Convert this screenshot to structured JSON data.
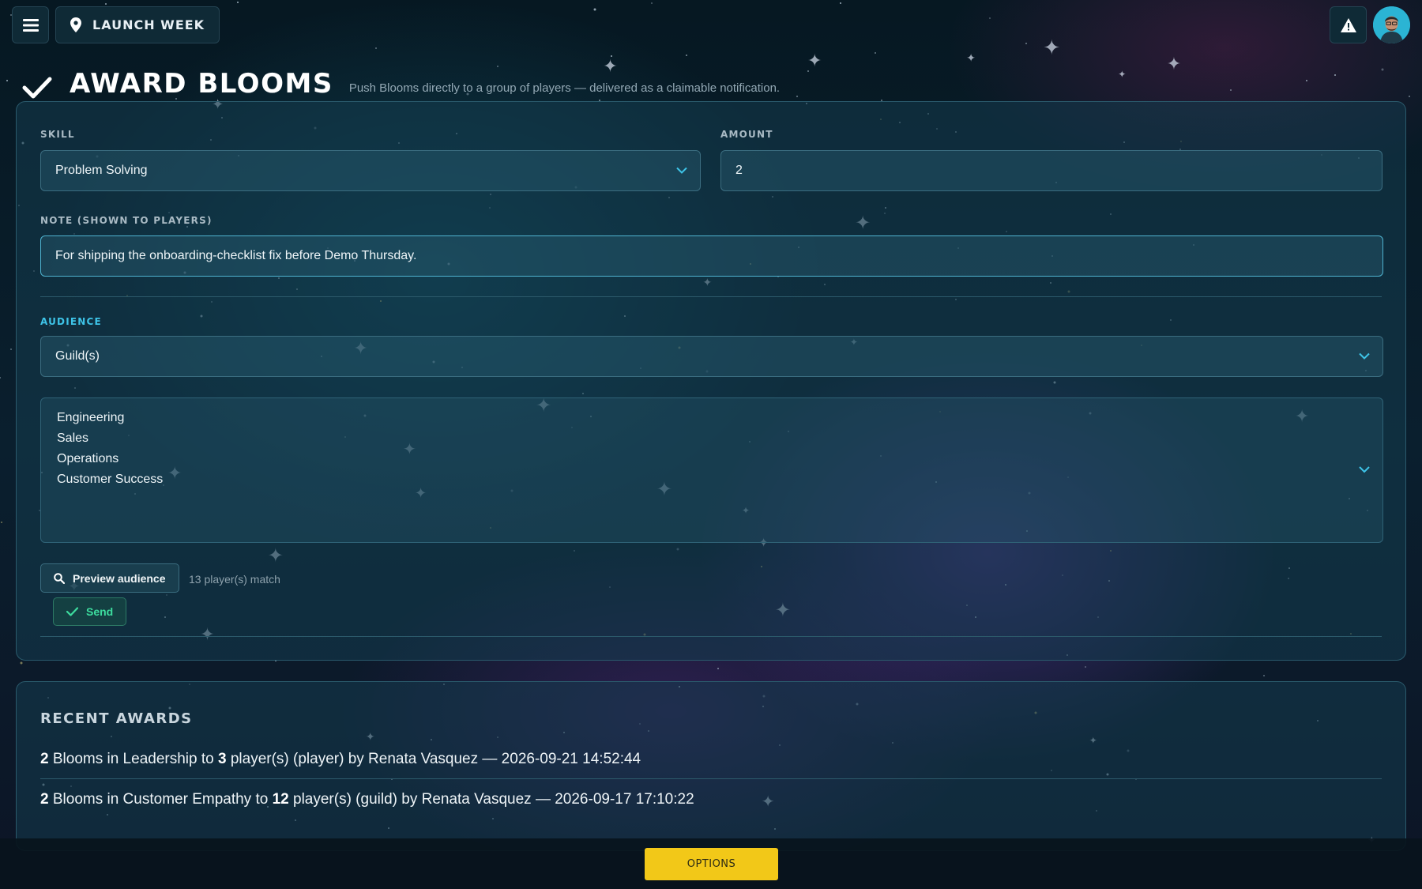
{
  "topbar": {
    "location_label": "LAUNCH WEEK",
    "menu_icon": "hamburger-menu-icon",
    "location_icon": "map-pin-icon",
    "alert_icon": "warning-icon"
  },
  "header": {
    "title": "AWARD BLOOMS",
    "subtitle": "Push Blooms directly to a group of players — delivered as a claimable notification."
  },
  "form": {
    "skill_label": "SKILL",
    "skill_value": "Problem Solving",
    "amount_label": "AMOUNT",
    "amount_value": "2",
    "note_label": "NOTE (SHOWN TO PLAYERS)",
    "note_value": "For shipping the onboarding-checklist fix before Demo Thursday.",
    "audience_label": "AUDIENCE",
    "audience_value": "Guild(s)",
    "guild_options": [
      "Engineering",
      "Sales",
      "Operations",
      "Customer Success"
    ],
    "preview_label": "Preview audience",
    "match_text": "13 player(s) match",
    "send_label": "Send"
  },
  "recent": {
    "title": "RECENT AWARDS",
    "awards": [
      {
        "amount": "2",
        "text1": " Blooms in Leadership to ",
        "count": "3",
        "text2": " player(s) (player) by Renata Vasquez — 2026-09-21 14:52:44"
      },
      {
        "amount": "2",
        "text1": " Blooms in Customer Empathy to ",
        "count": "12",
        "text2": " player(s) (guild) by Renata Vasquez — 2026-09-17 17:10:22"
      }
    ]
  },
  "footer": {
    "options_label": "OPTIONS"
  },
  "colors": {
    "accent": "#3ec4e8",
    "send_green": "#3ddc9e",
    "options_yellow": "#f2c818"
  }
}
